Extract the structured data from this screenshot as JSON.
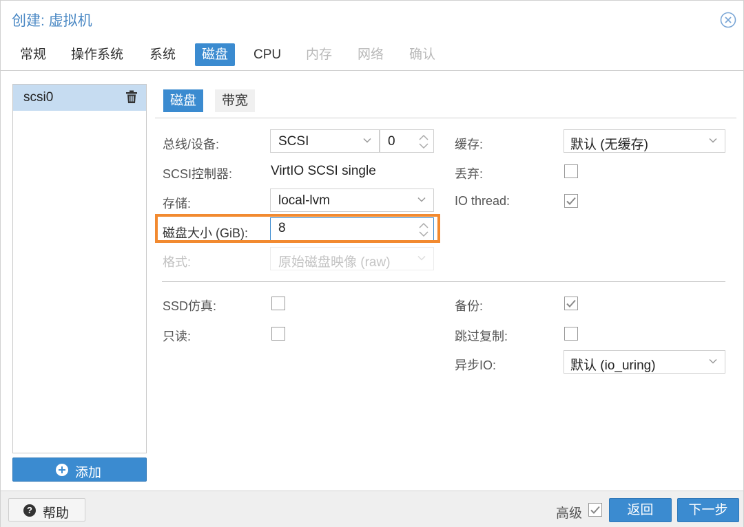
{
  "window": {
    "title": "创建: 虚拟机"
  },
  "tabs": [
    {
      "label": "常规"
    },
    {
      "label": "操作系统"
    },
    {
      "label": "系统"
    },
    {
      "label": "磁盘"
    },
    {
      "label": "CPU"
    },
    {
      "label": "内存"
    },
    {
      "label": "网络"
    },
    {
      "label": "确认"
    }
  ],
  "disks": {
    "items": [
      {
        "label": "scsi0"
      }
    ],
    "add_label": "添加"
  },
  "subtabs": {
    "disk": "磁盘",
    "bandwidth": "带宽"
  },
  "form": {
    "bus_label": "总线/设备:",
    "bus_value": "SCSI",
    "device_value": "0",
    "controller_label": "SCSI控制器:",
    "controller_value": "VirtIO SCSI single",
    "storage_label": "存储:",
    "storage_value": "local-lvm",
    "size_label": "磁盘大小 (GiB):",
    "size_value": "8",
    "format_label": "格式:",
    "format_value": "原始磁盘映像 (raw)",
    "cache_label": "缓存:",
    "cache_value": "默认 (无缓存)",
    "discard_label": "丢弃:",
    "discard_checked": false,
    "iothread_label": "IO thread:",
    "iothread_checked": true,
    "ssd_label": "SSD仿真:",
    "ssd_checked": false,
    "readonly_label": "只读:",
    "readonly_checked": false,
    "backup_label": "备份:",
    "backup_checked": true,
    "skip_repl_label": "跳过复制:",
    "skip_repl_checked": false,
    "async_label": "异步IO:",
    "async_value": "默认 (io_uring)"
  },
  "footer": {
    "help_label": "帮助",
    "advanced_label": "高级",
    "advanced_checked": true,
    "back_label": "返回",
    "next_label": "下一步"
  },
  "colors": {
    "accent": "#3b8bd0",
    "title": "#4a88c4",
    "highlight": "#f28a30",
    "selected_row": "#c6dcf1"
  }
}
